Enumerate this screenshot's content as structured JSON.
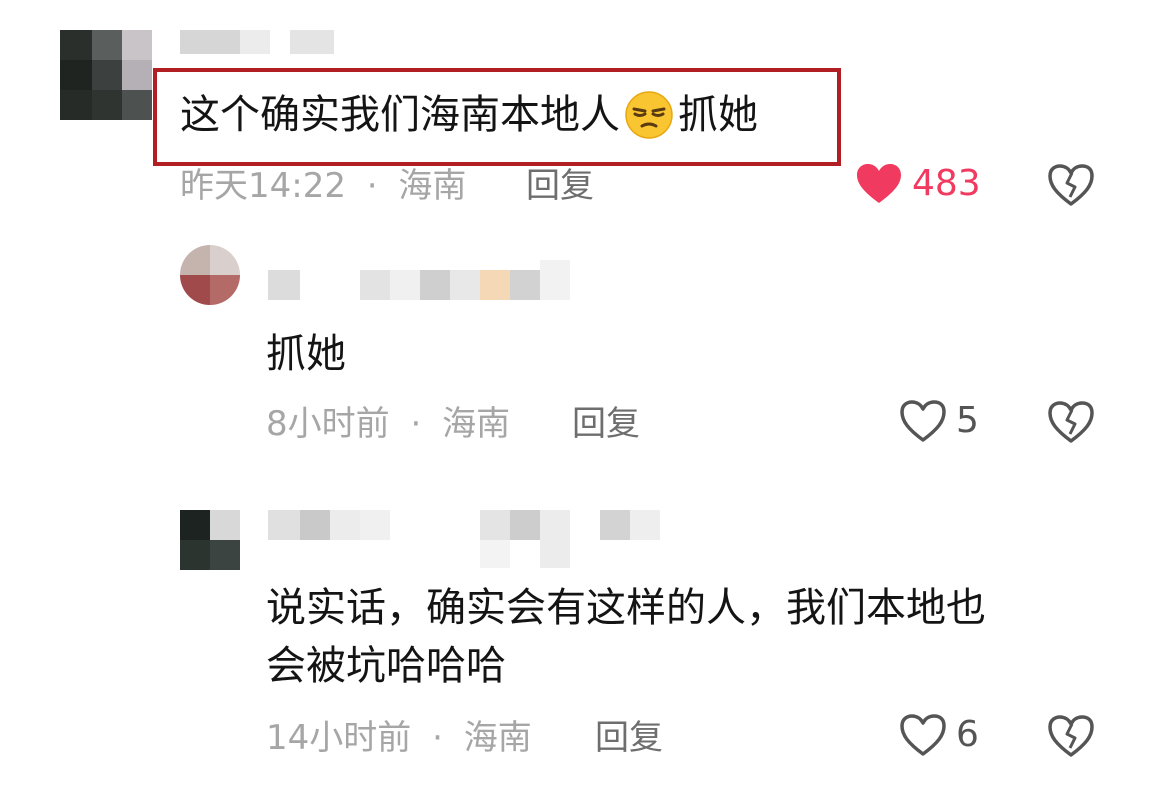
{
  "comments": [
    {
      "text": "这个确实我们海南本地人",
      "text_after_emoji": "抓她",
      "emoji": "smirk-emoji",
      "time": "昨天14:22",
      "separator": "·",
      "location": "海南",
      "reply_label": "回复",
      "like_count": "483",
      "liked": true,
      "highlight_color": "#b11f24",
      "like_color": "#f03a5f"
    },
    {
      "text": "抓她",
      "time": "8小时前",
      "separator": "·",
      "location": "海南",
      "reply_label": "回复",
      "like_count": "5",
      "liked": false
    },
    {
      "text_line1": "说实话，确实会有这样的人，我们本地也",
      "text_line2": "会被坑哈哈哈",
      "time": "14小时前",
      "separator": "·",
      "location": "海南",
      "reply_label": "回复",
      "like_count": "6",
      "liked": false
    }
  ]
}
